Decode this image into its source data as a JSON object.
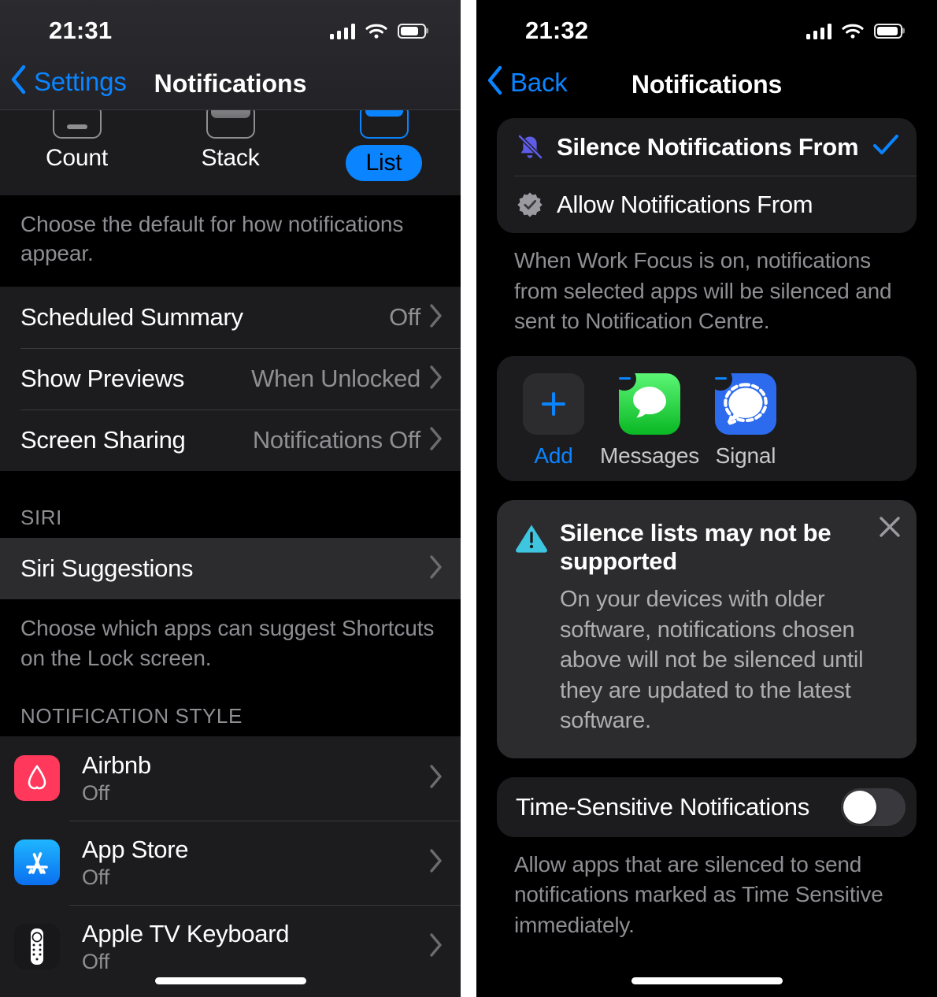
{
  "left_phone": {
    "status_bar": {
      "time": "21:31",
      "cellular_icon": "cellular-bars-icon",
      "wifi_icon": "wifi-icon",
      "battery_icon": "battery-icon"
    },
    "nav": {
      "back_label": "Settings",
      "title": "Notifications",
      "back_icon": "chevron-left-icon"
    },
    "display_style": {
      "options": [
        {
          "label": "Count",
          "selected": false,
          "preview": "count-preview-icon"
        },
        {
          "label": "Stack",
          "selected": false,
          "preview": "stack-preview-icon"
        },
        {
          "label": "List",
          "selected": true,
          "preview": "list-preview-icon"
        }
      ],
      "footnote": "Choose the default for how notifications appear."
    },
    "settings_rows": [
      {
        "title": "Scheduled Summary",
        "value": "Off"
      },
      {
        "title": "Show Previews",
        "value": "When Unlocked"
      },
      {
        "title": "Screen Sharing",
        "value": "Notifications Off"
      }
    ],
    "siri": {
      "header": "SIRI",
      "row_title": "Siri Suggestions",
      "footnote": "Choose which apps can suggest Shortcuts on the Lock screen."
    },
    "notification_style": {
      "header": "NOTIFICATION STYLE",
      "apps": [
        {
          "name": "Airbnb",
          "state": "Off",
          "icon": "airbnb-app-icon"
        },
        {
          "name": "App Store",
          "state": "Off",
          "icon": "app-store-app-icon"
        },
        {
          "name": "Apple TV Keyboard",
          "state": "Off",
          "icon": "apple-tv-remote-app-icon"
        }
      ]
    }
  },
  "right_phone": {
    "status_bar": {
      "time": "21:32",
      "cellular_icon": "cellular-bars-icon",
      "wifi_icon": "wifi-icon",
      "battery_icon": "battery-icon"
    },
    "nav": {
      "back_label": "Back",
      "title": "Notifications",
      "back_icon": "chevron-left-icon"
    },
    "mode_card": {
      "options": [
        {
          "label": "Silence Notifications From",
          "icon": "bell-slash-icon",
          "selected": true,
          "check_icon": "checkmark-icon"
        },
        {
          "label": "Allow Notifications From",
          "icon": "checkmark-seal-icon",
          "selected": false
        }
      ],
      "caption": "When Work Focus is on, notifications from selected apps will be silenced and sent to Notification Centre."
    },
    "apps_card": {
      "tiles": [
        {
          "label": "Add",
          "icon": "plus-icon",
          "removable": false
        },
        {
          "label": "Messages",
          "icon": "messages-app-icon",
          "removable": true,
          "remove_icon": "minus-badge-icon"
        },
        {
          "label": "Signal",
          "icon": "signal-app-icon",
          "removable": true,
          "remove_icon": "minus-badge-icon"
        }
      ]
    },
    "warning_card": {
      "icon": "warning-triangle-icon",
      "close_icon": "close-icon",
      "title": "Silence lists may not be supported",
      "body": "On your devices with older software, notifications chosen above will not be silenced until they are updated to the latest software."
    },
    "time_sensitive": {
      "label": "Time-Sensitive Notifications",
      "toggle_state": "off",
      "caption": "Allow apps that are silenced to send notifications marked as Time Sensitive immediately."
    }
  },
  "colors": {
    "accent_blue": "#0a84ff",
    "bell_purple": "#5e5ce6",
    "warning_cyan": "#3ec6e0",
    "messages_green": "#3cd84a",
    "signal_blue": "#2c6bed",
    "airbnb_red": "#ff385c",
    "card_bg": "#1c1c1e",
    "secondary_text": "#8e8e93"
  }
}
